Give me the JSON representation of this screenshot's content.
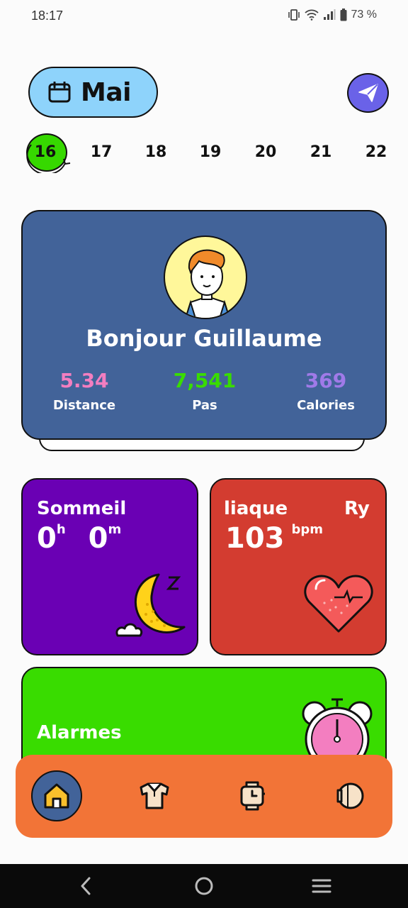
{
  "status_bar": {
    "time": "18:17",
    "battery": "73 %"
  },
  "header": {
    "month": "Mai"
  },
  "dates": [
    {
      "day": "16",
      "selected": true
    },
    {
      "day": "17",
      "selected": false
    },
    {
      "day": "18",
      "selected": false
    },
    {
      "day": "19",
      "selected": false
    },
    {
      "day": "20",
      "selected": false
    },
    {
      "day": "21",
      "selected": false
    },
    {
      "day": "22",
      "selected": false
    }
  ],
  "profile": {
    "greeting": "Bonjour Guillaume",
    "stats": [
      {
        "value": "5.34",
        "label": "Distance",
        "color": "#f37ec0"
      },
      {
        "value": "7,541",
        "label": "Pas",
        "color": "#39dc00"
      },
      {
        "value": "369",
        "label": "Calories",
        "color": "#a07ae8"
      }
    ]
  },
  "sleep": {
    "title": "Sommeil",
    "hours": "0",
    "hours_unit": "h",
    "minutes": "0",
    "minutes_unit": "m"
  },
  "heart": {
    "title": "liaque",
    "title_tail": "Ry",
    "value": "103",
    "unit": "bpm"
  },
  "alarms": {
    "title": "Alarmes"
  },
  "nav": {
    "items": [
      {
        "name": "home",
        "active": true
      },
      {
        "name": "shirt",
        "active": false
      },
      {
        "name": "watch",
        "active": false
      },
      {
        "name": "watch-side",
        "active": false
      }
    ]
  },
  "colors": {
    "profile_bg": "#426399",
    "sleep_bg": "#6a00b4",
    "heart_bg": "#d33c30",
    "alarm_bg": "#39dc00",
    "nav_bg": "#f27437",
    "accent": "#36d800"
  }
}
